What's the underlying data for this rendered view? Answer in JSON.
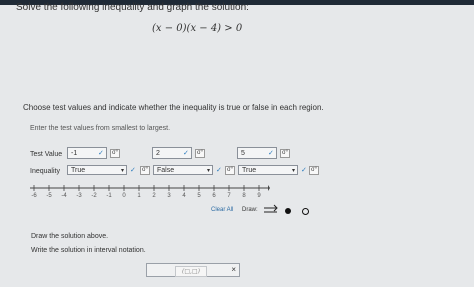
{
  "question": "Solve the following inequality and graph the solution:",
  "inequality": "(x − 0)(x − 4) > 0",
  "instruction": "Choose test values and indicate whether the inequality is true or false in each region.",
  "hint": "Enter the test values from smallest to largest.",
  "test_value_label": "Test Value",
  "inequality_label": "Inequality",
  "regions": [
    {
      "test_value": "-1",
      "result": "True"
    },
    {
      "test_value": "2",
      "result": "False"
    },
    {
      "test_value": "5",
      "result": "True"
    }
  ],
  "checkmark": "✓",
  "sigma": "σ°",
  "number_line": {
    "min": -6,
    "max": 10,
    "tick_labels": [
      "-6",
      "-5",
      "-4",
      "-3",
      "-2",
      "-1",
      "0",
      "1",
      "2",
      "3",
      "4",
      "5",
      "6",
      "7",
      "8",
      "9"
    ]
  },
  "tools": {
    "clear_all": "Clear All",
    "draw": "Draw:"
  },
  "draw_instruction": "Draw the solution above.",
  "write_instruction": "Write the solution in interval notation.",
  "answer_placeholder": "(□,□)",
  "answer_close": "×"
}
